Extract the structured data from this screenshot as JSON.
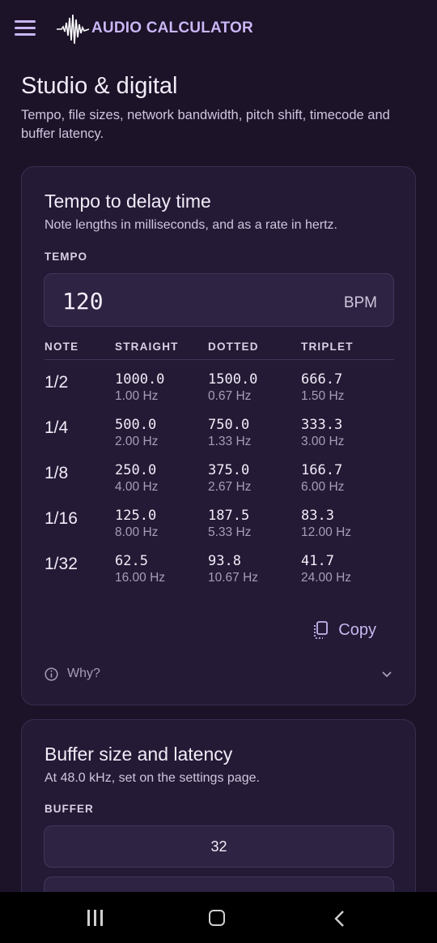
{
  "app": {
    "title": "AUDIO CALCULATOR",
    "accent": "#c9b6f0",
    "background": "#1c1329"
  },
  "page": {
    "title": "Studio & digital",
    "subtitle": "Tempo, file sizes, network bandwidth, pitch shift, timecode and buffer latency."
  },
  "tempo_card": {
    "title": "Tempo to delay time",
    "subtitle": "Note lengths in milliseconds, and as a rate in hertz.",
    "tempo_label": "TEMPO",
    "tempo_value": "120",
    "tempo_unit": "BPM",
    "columns": [
      "NOTE",
      "STRAIGHT",
      "DOTTED",
      "TRIPLET"
    ],
    "rows": [
      {
        "note": "1/2",
        "straight_ms": "1000.0",
        "straight_hz": "1.00 Hz",
        "dotted_ms": "1500.0",
        "dotted_hz": "0.67 Hz",
        "triplet_ms": "666.7",
        "triplet_hz": "1.50 Hz"
      },
      {
        "note": "1/4",
        "straight_ms": "500.0",
        "straight_hz": "2.00 Hz",
        "dotted_ms": "750.0",
        "dotted_hz": "1.33 Hz",
        "triplet_ms": "333.3",
        "triplet_hz": "3.00 Hz"
      },
      {
        "note": "1/8",
        "straight_ms": "250.0",
        "straight_hz": "4.00 Hz",
        "dotted_ms": "375.0",
        "dotted_hz": "2.67 Hz",
        "triplet_ms": "166.7",
        "triplet_hz": "6.00 Hz"
      },
      {
        "note": "1/16",
        "straight_ms": "125.0",
        "straight_hz": "8.00 Hz",
        "dotted_ms": "187.5",
        "dotted_hz": "5.33 Hz",
        "triplet_ms": "83.3",
        "triplet_hz": "12.00 Hz"
      },
      {
        "note": "1/32",
        "straight_ms": "62.5",
        "straight_hz": "16.00 Hz",
        "dotted_ms": "93.8",
        "dotted_hz": "10.67 Hz",
        "triplet_ms": "41.7",
        "triplet_hz": "24.00 Hz"
      }
    ],
    "copy_label": "Copy",
    "why_label": "Why?"
  },
  "buffer_card": {
    "title": "Buffer size and latency",
    "subtitle": "At 48.0 kHz, set on the settings page.",
    "buffer_label": "BUFFER",
    "options": [
      "32"
    ]
  },
  "icons": {
    "menu": "menu-icon",
    "logo": "waveform-icon",
    "copy": "copy-icon",
    "info": "info-icon",
    "expand": "chevron-down-icon",
    "nav_recent": "recent-apps-icon",
    "nav_home": "home-icon",
    "nav_back": "back-icon"
  }
}
